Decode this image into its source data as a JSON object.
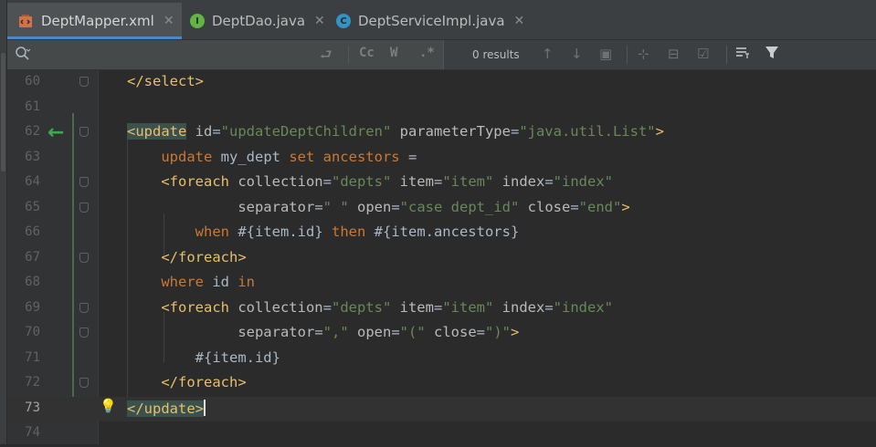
{
  "tabs": [
    {
      "label": "DeptMapper.xml",
      "icon": "xml-file-icon",
      "active": true
    },
    {
      "label": "DeptDao.java",
      "icon": "interface-icon",
      "icon_letter": "I",
      "icon_color": "#62b543"
    },
    {
      "label": "DeptServiceImpl.java",
      "icon": "class-icon",
      "icon_letter": "C",
      "icon_color": "#3592c4"
    }
  ],
  "search": {
    "placeholder": "",
    "value": "",
    "options": [
      "Cc",
      "W",
      ".*"
    ],
    "results": "0 results"
  },
  "editor": {
    "lines": [
      {
        "n": "60",
        "tokens": [
          {
            "t": "</select>",
            "c": "tag"
          }
        ]
      },
      {
        "n": "61",
        "tokens": []
      },
      {
        "n": "62",
        "tokens": [
          {
            "t": "<update",
            "c": "tag hl"
          },
          {
            "t": " id",
            "c": "attr"
          },
          {
            "t": "=",
            "c": "txt"
          },
          {
            "t": "\"updateDeptChildren\"",
            "c": "val"
          },
          {
            "t": " parameterType",
            "c": "attr"
          },
          {
            "t": "=",
            "c": "txt"
          },
          {
            "t": "\"java.util.List\"",
            "c": "val"
          },
          {
            "t": ">",
            "c": "tag"
          }
        ]
      },
      {
        "n": "63",
        "tokens": [
          {
            "t": "    update ",
            "c": "kw"
          },
          {
            "t": "my_dept ",
            "c": "txt"
          },
          {
            "t": "set ",
            "c": "kw"
          },
          {
            "t": "ancestors",
            "c": "kw"
          },
          {
            "t": " =",
            "c": "txt"
          }
        ]
      },
      {
        "n": "64",
        "tokens": [
          {
            "t": "    <foreach",
            "c": "tag"
          },
          {
            "t": " collection",
            "c": "attr"
          },
          {
            "t": "=",
            "c": "txt"
          },
          {
            "t": "\"depts\"",
            "c": "val"
          },
          {
            "t": " item",
            "c": "attr"
          },
          {
            "t": "=",
            "c": "txt"
          },
          {
            "t": "\"item\"",
            "c": "val"
          },
          {
            "t": " index",
            "c": "attr"
          },
          {
            "t": "=",
            "c": "txt"
          },
          {
            "t": "\"index\"",
            "c": "val"
          }
        ]
      },
      {
        "n": "65",
        "tokens": [
          {
            "t": "             separator",
            "c": "attr"
          },
          {
            "t": "=",
            "c": "txt"
          },
          {
            "t": "\" \"",
            "c": "val"
          },
          {
            "t": " open",
            "c": "attr"
          },
          {
            "t": "=",
            "c": "txt"
          },
          {
            "t": "\"case dept_id\"",
            "c": "val"
          },
          {
            "t": " close",
            "c": "attr"
          },
          {
            "t": "=",
            "c": "txt"
          },
          {
            "t": "\"end\"",
            "c": "val"
          },
          {
            "t": ">",
            "c": "tag"
          }
        ]
      },
      {
        "n": "66",
        "tokens": [
          {
            "t": "        when ",
            "c": "kw"
          },
          {
            "t": "#{item.id} ",
            "c": "txt"
          },
          {
            "t": "then ",
            "c": "kw"
          },
          {
            "t": "#{item.ancestors}",
            "c": "txt"
          }
        ]
      },
      {
        "n": "67",
        "tokens": [
          {
            "t": "    </foreach>",
            "c": "tag"
          }
        ]
      },
      {
        "n": "68",
        "tokens": [
          {
            "t": "    where ",
            "c": "kw"
          },
          {
            "t": "id ",
            "c": "txt"
          },
          {
            "t": "in",
            "c": "kw"
          }
        ]
      },
      {
        "n": "69",
        "tokens": [
          {
            "t": "    <foreach",
            "c": "tag"
          },
          {
            "t": " collection",
            "c": "attr"
          },
          {
            "t": "=",
            "c": "txt"
          },
          {
            "t": "\"depts\"",
            "c": "val"
          },
          {
            "t": " item",
            "c": "attr"
          },
          {
            "t": "=",
            "c": "txt"
          },
          {
            "t": "\"item\"",
            "c": "val"
          },
          {
            "t": " index",
            "c": "attr"
          },
          {
            "t": "=",
            "c": "txt"
          },
          {
            "t": "\"index\"",
            "c": "val"
          }
        ]
      },
      {
        "n": "70",
        "tokens": [
          {
            "t": "             separator",
            "c": "attr"
          },
          {
            "t": "=",
            "c": "txt"
          },
          {
            "t": "\",\"",
            "c": "val"
          },
          {
            "t": " open",
            "c": "attr"
          },
          {
            "t": "=",
            "c": "txt"
          },
          {
            "t": "\"(\"",
            "c": "val"
          },
          {
            "t": " close",
            "c": "attr"
          },
          {
            "t": "=",
            "c": "txt"
          },
          {
            "t": "\")\"",
            "c": "val"
          },
          {
            "t": ">",
            "c": "tag"
          }
        ]
      },
      {
        "n": "71",
        "tokens": [
          {
            "t": "        #{item.id}",
            "c": "txt"
          }
        ]
      },
      {
        "n": "72",
        "tokens": [
          {
            "t": "    </foreach>",
            "c": "tag"
          }
        ]
      },
      {
        "n": "73",
        "tokens": [
          {
            "t": "</update",
            "c": "tag hl"
          },
          {
            "t": ">",
            "c": "tag hl"
          }
        ],
        "current": true
      },
      {
        "n": "74",
        "tokens": []
      }
    ],
    "fold_lines": [
      "60",
      "62",
      "64",
      "65",
      "67",
      "69",
      "70",
      "72"
    ],
    "gutter_arrow_line": "62",
    "bulb_line": "73"
  }
}
